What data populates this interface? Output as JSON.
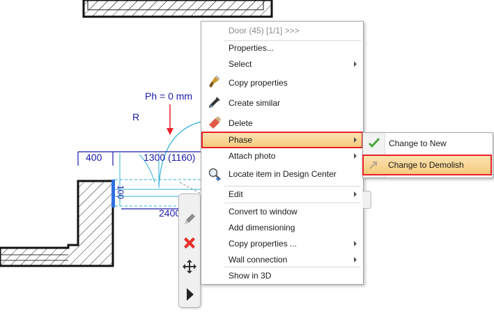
{
  "drawing": {
    "phase_height_label": "Ph = 0 mm",
    "r_label": "R",
    "dim_left": "400",
    "dim_top": "1300 (1160)",
    "dim_bottom": "2400",
    "dim_vertical": "100"
  },
  "context_menu": {
    "header": "Door (45) [1/1] >>>",
    "items": [
      {
        "label": "Properties..."
      },
      {
        "label": "Select"
      },
      {
        "label": "Copy properties"
      },
      {
        "label": "Create similar"
      },
      {
        "label": "Delete"
      },
      {
        "label": "Phase"
      },
      {
        "label": "Attach photo"
      },
      {
        "label": "Locate item in Design Center"
      },
      {
        "label": "Edit"
      },
      {
        "label": "Convert to window"
      },
      {
        "label": "Add dimensioning"
      },
      {
        "label": "Copy properties ..."
      },
      {
        "label": "Wall connection"
      },
      {
        "label": "Show in 3D"
      }
    ]
  },
  "phase_submenu": {
    "items": [
      {
        "label": "Change to New"
      },
      {
        "label": "Change to Demolish"
      }
    ]
  },
  "colors": {
    "dimension": "#1a1aa8",
    "door_swing": "#2fb0d8",
    "highlight_border": "#e8202a",
    "red_arrow": "#e8202a"
  }
}
